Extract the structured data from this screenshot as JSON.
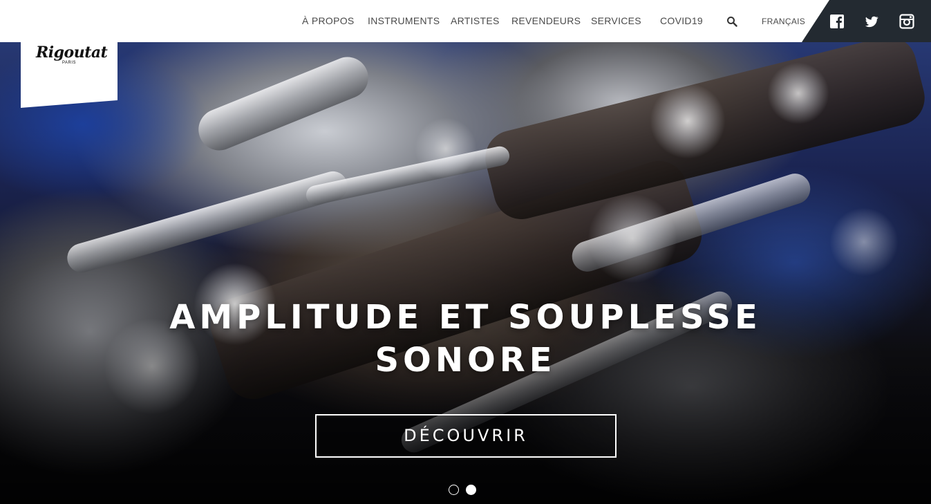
{
  "header": {
    "nav": [
      {
        "label": "À PROPOS"
      },
      {
        "label": "INSTRUMENTS"
      },
      {
        "label": "ARTISTES"
      },
      {
        "label": "REVENDEURS"
      },
      {
        "label": "SERVICES"
      },
      {
        "label": "COVID19"
      }
    ],
    "search_icon": "search-icon",
    "language": "FRANÇAIS",
    "social": [
      {
        "icon": "facebook-icon"
      },
      {
        "icon": "twitter-icon"
      },
      {
        "icon": "instagram-icon"
      }
    ]
  },
  "logo": {
    "name": "Rigoutat",
    "sub": "PARIS"
  },
  "hero": {
    "headline_line1": "AMPLITUDE ET SOUPLESSE",
    "headline_line2": "SONORE",
    "cta_label": "DÉCOUVRIR",
    "slides": 2,
    "active_slide": 2
  },
  "colors": {
    "header_bg": "#ffffff",
    "social_bg": "#232a31",
    "nav_text": "#4a4a4a",
    "hero_text": "#ffffff"
  }
}
